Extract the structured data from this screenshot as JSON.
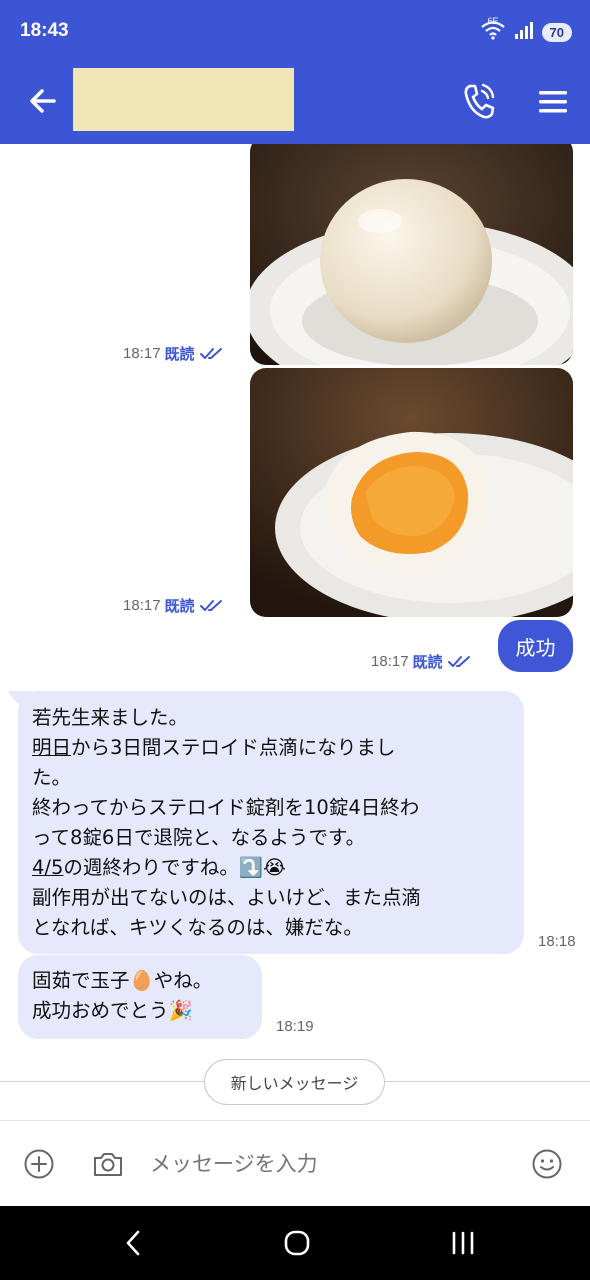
{
  "status": {
    "time": "18:43",
    "network": "6E",
    "battery": "70"
  },
  "header": {
    "contact_name": ""
  },
  "messages": {
    "photo1": {
      "time": "18:17",
      "read": "既読"
    },
    "photo2": {
      "time": "18:17",
      "read": "既読"
    },
    "outgoing1": {
      "text": "成功",
      "time": "18:17",
      "read": "既読"
    },
    "incoming1": {
      "lines": [
        "若先生来ました。",
        "明日",
        "から3日間ステロイド点滴になりまし",
        "た。",
        "終わってからステロイド錠剤を10錠4日終わ",
        "って8錠6日で退院と、なるようです。",
        "4/5",
        "の週終わりですね。⤵️😭",
        "副作用が出てないのは、よいけど、また点滴",
        "となれば、キツくなるのは、嫌だな。"
      ],
      "time": "18:18"
    },
    "incoming2": {
      "lines": [
        "固茹で玉子🥚やね。",
        "成功おめでとう🎉"
      ],
      "time": "18:19"
    }
  },
  "new_messages_label": "新しいメッセージ",
  "input": {
    "placeholder": "メッセージを入力"
  },
  "colors": {
    "brand": "#3c55d4",
    "incoming_bubble": "#e6e9fb",
    "outgoing_bubble": "#3f56d6"
  }
}
